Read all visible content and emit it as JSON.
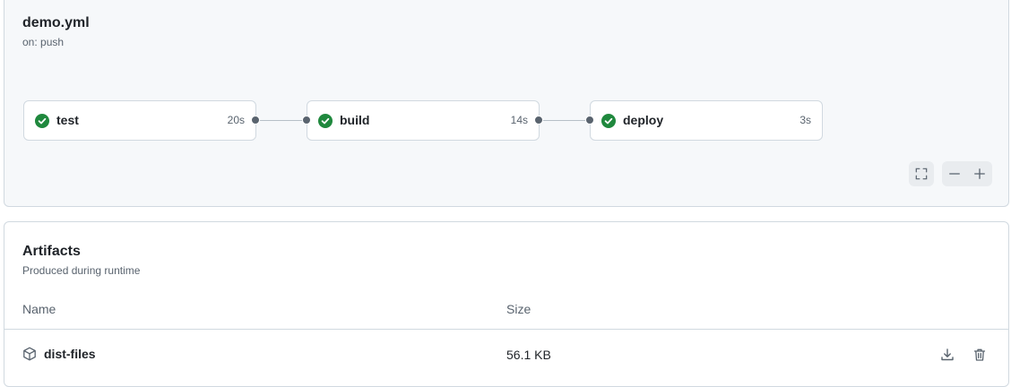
{
  "workflow": {
    "file": "demo.yml",
    "trigger": "on: push",
    "jobs": [
      {
        "name": "test",
        "duration": "20s",
        "status": "success"
      },
      {
        "name": "build",
        "duration": "14s",
        "status": "success"
      },
      {
        "name": "deploy",
        "duration": "3s",
        "status": "success"
      }
    ],
    "controls": [
      "fullscreen-icon",
      "zoom-out-icon",
      "zoom-in-icon"
    ]
  },
  "artifacts": {
    "title": "Artifacts",
    "subtitle": "Produced during runtime",
    "columns": {
      "name": "Name",
      "size": "Size"
    },
    "rows": [
      {
        "name": "dist-files",
        "size": "56.1 KB",
        "icon": "package-icon"
      }
    ]
  },
  "colors": {
    "success": "#1f883d",
    "panel_bg": "#f6f8fa",
    "border": "#d1d9e0",
    "muted_text": "#59636e"
  }
}
